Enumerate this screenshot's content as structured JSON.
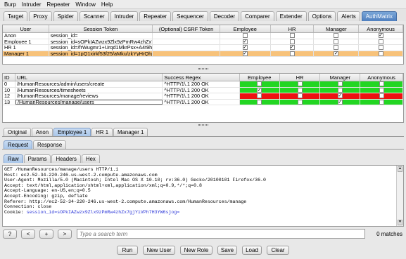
{
  "menu": [
    "Burp",
    "Intruder",
    "Repeater",
    "Window",
    "Help"
  ],
  "tabs": [
    "Target",
    "Proxy",
    "Spider",
    "Scanner",
    "Intruder",
    "Repeater",
    "Sequencer",
    "Decoder",
    "Comparer",
    "Extender",
    "Options",
    "Alerts",
    "AuthMatrix"
  ],
  "users": {
    "headers": [
      "User",
      "Session Token",
      "(Optional) CSRF Token",
      "Employee",
      "HR",
      "Manager",
      "Anonymous"
    ],
    "rows": [
      {
        "user": "Anon",
        "token": "session_id=",
        "csrf": "",
        "roles": [
          false,
          false,
          false,
          true
        ],
        "selected": false
      },
      {
        "user": "Employee 1",
        "token": "session_id=sOPkIAZwzx9Zlx9zPmRw4zhZx7gjYiVPh...",
        "csrf": "",
        "roles": [
          true,
          false,
          false,
          false
        ],
        "selected": false
      },
      {
        "user": "HR 1",
        "token": "session_id=/frWugmr1+Urqd1MkrPsx+A4t9hi+M...",
        "csrf": "",
        "roles": [
          true,
          true,
          false,
          false
        ],
        "selected": false
      },
      {
        "user": "Manager 1",
        "token": "session_id=1pQ1xirkf53f25/aMku/zkYyHrQhpg8vp...",
        "csrf": "",
        "roles": [
          true,
          false,
          true,
          false
        ],
        "selected": true
      }
    ]
  },
  "requests": {
    "headers": [
      "ID",
      "URL",
      "Success Regex",
      "Employee",
      "HR",
      "Manager",
      "Anonymous"
    ],
    "rows": [
      {
        "id": "0",
        "url": "/HumanResources/admin/users/create",
        "regex": "^HTTP/1\\.1 200 OK",
        "roles": [
          false,
          false,
          false,
          false
        ],
        "color": "green",
        "selected": false
      },
      {
        "id": "10",
        "url": "/HumanResources/timesheets",
        "regex": "^HTTP/1\\.1 200 OK",
        "roles": [
          true,
          false,
          false,
          false
        ],
        "color": "green",
        "selected": false
      },
      {
        "id": "12",
        "url": "/HumanResources/manage/reviews",
        "regex": "^HTTP/1\\.1 200 OK",
        "roles": [
          false,
          false,
          true,
          false
        ],
        "color": "red",
        "selected": false
      },
      {
        "id": "13",
        "url": "/HumanResources/manage/users",
        "regex": "^HTTP/1\\.1 200 OK",
        "roles": [
          false,
          false,
          true,
          false
        ],
        "color": "green",
        "selected": true
      }
    ]
  },
  "user_tabs": [
    "Original",
    "Anon",
    "Employee 1",
    "HR 1",
    "Manager 1"
  ],
  "active_user_tab": 2,
  "msg_tabs": [
    "Request",
    "Response"
  ],
  "view_tabs": [
    "Raw",
    "Params",
    "Headers",
    "Hex"
  ],
  "raw_lines": [
    "GET /HumanResources/manage/users HTTP/1.1",
    "Host: ec2-52-34-220-246.us-west-2.compute.amazonaws.com",
    "User-Agent: Mozilla/5.0 (Macintosh; Intel Mac OS X 10.10; rv:36.0) Gecko/20100101 Firefox/36.0",
    "Accept: text/html,application/xhtml+xml,application/xml;q=0.9,*/*;q=0.8",
    "Accept-Language: en-US,en;q=0.5",
    "Accept-Encoding: gzip, deflate",
    "Referer: http://ec2-52-34-220-246.us-west-2.compute.amazonaws.com/HumanResources/manage",
    "Connection: close"
  ],
  "cookie_prefix": "Cookie: ",
  "cookie_value": "session_id=sOPkIAZwzx9Zlx9zPmRw4zhZx7gjYiVPh7H3YW6sjog=",
  "search": {
    "placeholder": "Type a search term",
    "matches": "0 matches",
    "help": "?",
    "prev": "<",
    "add": "+",
    "next": ">"
  },
  "actions": [
    "Run",
    "New User",
    "New Role",
    "Save",
    "Load",
    "Clear"
  ]
}
